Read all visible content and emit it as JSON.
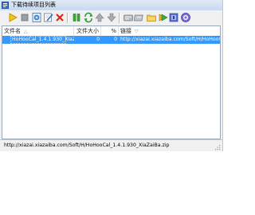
{
  "window": {
    "title": "下载待续项目列表"
  },
  "toolbar": {
    "buttons": [
      {
        "name": "start-download-button",
        "icon": "play-icon"
      },
      {
        "name": "stop-button",
        "icon": "stop-icon"
      },
      {
        "name": "properties-button",
        "icon": "properties-icon"
      },
      {
        "name": "edit-button",
        "icon": "edit-icon"
      },
      {
        "name": "delete-button",
        "icon": "delete-icon"
      },
      {
        "name": "pause-button",
        "icon": "pause-icon"
      },
      {
        "name": "refresh-button",
        "icon": "refresh-icon"
      },
      {
        "name": "move-up-button",
        "icon": "arrow-up-icon"
      },
      {
        "name": "move-down-button",
        "icon": "arrow-down-icon"
      },
      {
        "name": "import-button",
        "icon": "import-icon"
      },
      {
        "name": "export-button",
        "icon": "export-icon"
      },
      {
        "name": "open-folder-button",
        "icon": "folder-icon"
      },
      {
        "name": "schedule-button",
        "icon": "schedule-icon"
      },
      {
        "name": "help-button",
        "icon": "help-icon"
      },
      {
        "name": "about-button",
        "icon": "about-icon"
      }
    ]
  },
  "list": {
    "columns": [
      {
        "label": "文件名",
        "sort": "△"
      },
      {
        "label": "文件大小"
      },
      {
        "label": "%"
      },
      {
        "label": "链接",
        "sort": "▽"
      }
    ],
    "rows": [
      {
        "name": "HoHooCal_1.4.1.930_XiaZ...",
        "size": "0",
        "percent": "0",
        "link": "http://xiazai.xiazaiba.com/Soft/H/HoHooCal_1.4.1.930_XiaZ..."
      }
    ]
  },
  "statusbar": {
    "text": "http://xiazai.xiazaiba.com/Soft/H/HoHooCal_1.4.1.930_XiaZaiBa.zip"
  },
  "colors": {
    "selection": "#3399ff",
    "titlebar": "#c8d9ee"
  }
}
